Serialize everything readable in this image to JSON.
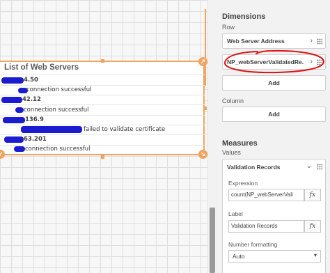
{
  "table": {
    "title": "List of Web Servers",
    "rows": [
      {
        "ip": "4.50",
        "status": "connection successful"
      },
      {
        "ip": "42.12",
        "status": "connection successful"
      },
      {
        "ip": "136.9",
        "status": "failed to validate certificate"
      },
      {
        "ip": "63.201",
        "status": "connection successful"
      }
    ]
  },
  "panel": {
    "dimensions_title": "Dimensions",
    "row_label": "Row",
    "dimension_items": [
      "Web Server Address",
      "NP_webServerValidatedRe..."
    ],
    "add_label": "Add",
    "column_label": "Column",
    "measures_title": "Measures",
    "values_label": "Values",
    "measure": {
      "name": "Validation Records",
      "expression_label": "Expression",
      "expression_value": "count(NP_webServerVali",
      "label_label": "Label",
      "label_value": "Validation Records",
      "number_format_label": "Number formatting",
      "number_format_value": "Auto"
    },
    "fx_label": "fx"
  },
  "colors": {
    "selection": "#f3a35e",
    "annotation": "#e01010",
    "redaction": "#1b1bcf"
  }
}
